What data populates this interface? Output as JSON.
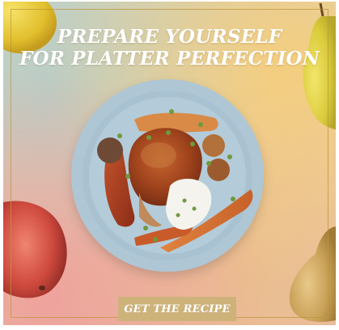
{
  "ad": {
    "headline_line1": "PREPARE YOURSELF",
    "headline_line2": "FOR PLATTER PERFECTION",
    "cta_label": "GET THE RECIPE"
  },
  "colors": {
    "frame": "#c8a24a",
    "cta_background": "#cdb27a",
    "plate": "#a9c2d1",
    "headline_text": "#ffffff"
  }
}
